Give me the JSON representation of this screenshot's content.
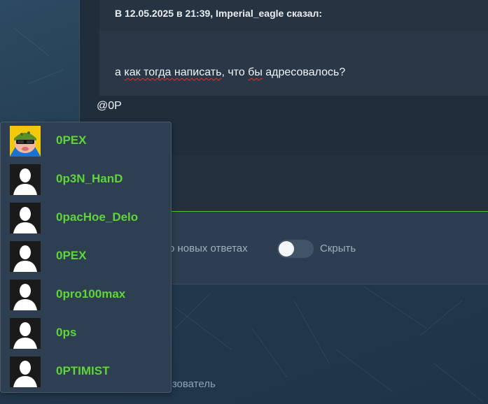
{
  "quote": {
    "author_line": "В 12.05.2025 в 21:39, Imperial_eagle сказал:",
    "text_before": "а ",
    "text_misspelled_1": "как тогда написать",
    "text_middle": ", что ",
    "text_misspelled_2": "бы",
    "text_after": " адресовалось?"
  },
  "editor": {
    "text": "@0P"
  },
  "options": {
    "notify_label": "ь о новых ответах",
    "hide_label": "Скрыть",
    "user_label": "ьзователь"
  },
  "mention_suggestions": [
    {
      "name": "0PEX",
      "avatar": "soldier-avatar"
    },
    {
      "name": "0p3N_HanD",
      "avatar": "default-avatar"
    },
    {
      "name": "0pacHoe_Delo",
      "avatar": "default-avatar"
    },
    {
      "name": "0PEX",
      "avatar": "default-avatar"
    },
    {
      "name": "0pro100max",
      "avatar": "default-avatar"
    },
    {
      "name": "0ps",
      "avatar": "default-avatar"
    },
    {
      "name": "0PTIMIST",
      "avatar": "default-avatar"
    }
  ],
  "colors": {
    "accent_green": "#5fd53a",
    "spellcheck_red": "#e0332e",
    "panel_bg": "#202d3b"
  }
}
